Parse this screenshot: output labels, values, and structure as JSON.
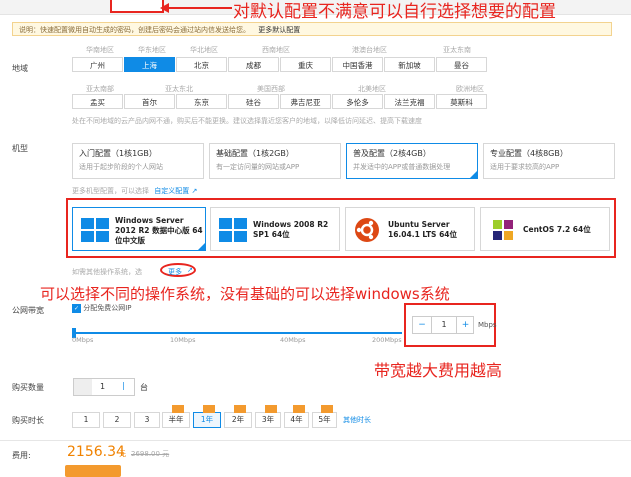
{
  "annotations": {
    "config": "对默认配置不满意可以自行选择想要的配置",
    "os": "可以选择不同的操作系统，没有基础的可以选择windows系统",
    "bandwidth": "带宽越大费用越高"
  },
  "notice": {
    "text": "说明：快速配置微用自动生成的密码，创建后密码会通过站内信发送给您。",
    "link": "更多默认配置"
  },
  "region": {
    "label": "地域",
    "row1_groups": [
      "华南地区",
      "华东地区",
      "华北地区",
      "西南地区",
      "港澳台地区",
      "亚太东南"
    ],
    "row1": [
      "广州",
      "上海",
      "北京",
      "成都",
      "重庆",
      "中国香港",
      "新加坡",
      "曼谷"
    ],
    "row2_groups": [
      "亚太南部",
      "亚太东北",
      "美国西部",
      "北美地区",
      "欧洲地区"
    ],
    "row2": [
      "孟买",
      "首尔",
      "东京",
      "硅谷",
      "弗吉尼亚",
      "多伦多",
      "法兰克福",
      "莫斯科"
    ],
    "selected": "上海",
    "hint": "处在不同地域的云产品内网不通，购买后不能更换。建议选择靠近您客户的地域，以降低访问延迟、提高下载速度"
  },
  "machine": {
    "label": "机型",
    "cards": [
      {
        "title": "入门配置（1核1GB）",
        "desc": "适用于起步阶段的个人网站"
      },
      {
        "title": "基础配置（1核2GB）",
        "desc": "有一定访问量的网站或APP"
      },
      {
        "title": "普及配置（2核4GB）",
        "desc": "并发适中的APP或普通数据处理"
      },
      {
        "title": "专业配置（4核8GB）",
        "desc": "适用于要求较高的APP"
      }
    ],
    "more_text": "更多机型配置，可以选择",
    "custom_link": "自定义配置"
  },
  "os": {
    "items": [
      {
        "name": "Windows Server 2012 R2 数据中心版 64位中文版",
        "icon": "windows-icon"
      },
      {
        "name": "Windows 2008 R2 SP1 64位",
        "icon": "windows-icon"
      },
      {
        "name": "Ubuntu Server 16.04.1 LTS 64位",
        "icon": "ubuntu-icon"
      },
      {
        "name": "CentOS 7.2 64位",
        "icon": "centos-icon"
      }
    ],
    "more_text": "如需其他操作系统，选",
    "more_link": "更多"
  },
  "bandwidth": {
    "label": "公网带宽",
    "checkbox": "分配免费公网IP",
    "ticks": [
      "0Mbps",
      "10Mbps",
      "40Mbps",
      "200Mbps"
    ],
    "value": "1",
    "unit": "Mbps",
    "minus": "−",
    "plus": "+"
  },
  "quantity": {
    "label": "购买数量",
    "value": "1",
    "unit": "台"
  },
  "duration": {
    "label": "购买时长",
    "options": [
      "1",
      "2",
      "3",
      "半年",
      "1年",
      "2年",
      "3年",
      "4年",
      "5年"
    ],
    "selected": "1年",
    "other": "其他时长"
  },
  "price": {
    "label": "费用:",
    "value": "2156.34",
    "unit": "元",
    "original": "2698.00 元"
  },
  "colors": {
    "accent": "#0f8be6",
    "annotation": "#e8251f",
    "price": "#f08200"
  }
}
